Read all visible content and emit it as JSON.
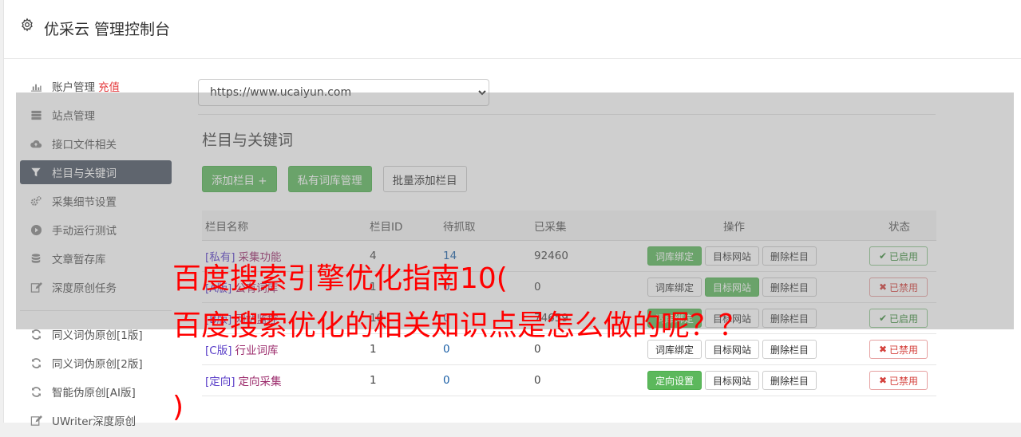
{
  "header": {
    "title": "优采云 管理控制台"
  },
  "sidebar": {
    "items": [
      {
        "label": "账户管理",
        "extra": "充值",
        "icon": "bar-chart-icon"
      },
      {
        "label": "站点管理",
        "icon": "server-icon"
      },
      {
        "label": "接口文件相关",
        "icon": "cloud-upload-icon"
      },
      {
        "label": "栏目与关键词",
        "icon": "filter-icon",
        "active": true
      },
      {
        "label": "采集细节设置",
        "icon": "cogs-icon"
      },
      {
        "label": "手动运行测试",
        "icon": "play-circle-icon"
      },
      {
        "label": "文章暂存库",
        "icon": "database-icon"
      },
      {
        "label": "深度原创任务",
        "icon": "edit-icon"
      },
      {
        "label": "同义词伪原创[1版]",
        "icon": "refresh-icon"
      },
      {
        "label": "同义词伪原创[2版]",
        "icon": "refresh-icon"
      },
      {
        "label": "智能伪原创[AI版]",
        "icon": "refresh-icon"
      },
      {
        "label": "UWriter深度原创",
        "icon": "edit-icon"
      }
    ]
  },
  "main": {
    "site_select": "https://www.ucaiyun.com",
    "section_title": "栏目与关键词",
    "buttons": {
      "add": "添加栏目 +",
      "private": "私有词库管理",
      "batch": "批量添加栏目"
    },
    "table": {
      "headers": {
        "name": "栏目名称",
        "id": "栏目ID",
        "wait": "待抓取",
        "done": "已采集",
        "op": "操作",
        "status": "状态"
      },
      "rows": [
        {
          "tag": "[私有]",
          "name": "采集功能",
          "id": "4",
          "wait": "14",
          "done": "92460",
          "op1": "词库绑定",
          "op1_green": true,
          "op2": "目标网站",
          "op2_green": false,
          "op3": "删除栏目",
          "status": "已启用",
          "on": true
        },
        {
          "tag": "[A版]",
          "name": "公有词库",
          "id": "1",
          "wait": "0",
          "done": "0",
          "op1": "词库绑定",
          "op1_green": false,
          "op2": "目标网站",
          "op2_green": true,
          "op3": "删除栏目",
          "status": "已禁用",
          "on": false
        },
        {
          "tag": "[B版]",
          "name": "网站监控",
          "id": "10",
          "wait": "0",
          "done": "74659",
          "op1": "词库绑定",
          "op1_green": true,
          "op2": "目标网站",
          "op2_green": false,
          "op3": "删除栏目",
          "status": "已启用",
          "on": true
        },
        {
          "tag": "[C版]",
          "name": "行业词库",
          "id": "1",
          "wait": "0",
          "done": "0",
          "op1": "词库绑定",
          "op1_green": false,
          "op2": "目标网站",
          "op2_green": false,
          "op3": "删除栏目",
          "status": "已禁用",
          "on": false
        },
        {
          "tag": "[定向]",
          "name": "定向采集",
          "id": "1",
          "wait": "0",
          "done": "0",
          "op1": "定向设置",
          "op1_green": true,
          "op2": "目标网站",
          "op2_green": false,
          "op3": "删除栏目",
          "status": "已禁用",
          "on": false
        }
      ]
    }
  },
  "overlay_text": {
    "line1": "百度搜索引擎优化指南10(",
    "line2": "百度搜索优化的相关知识点是怎么做的呢？？",
    "line3": ")"
  },
  "colors": {
    "green": "#5cb85c",
    "active_nav": "#4b5563",
    "overlay_red": "#ff0000",
    "recharge": "#e4393c"
  }
}
